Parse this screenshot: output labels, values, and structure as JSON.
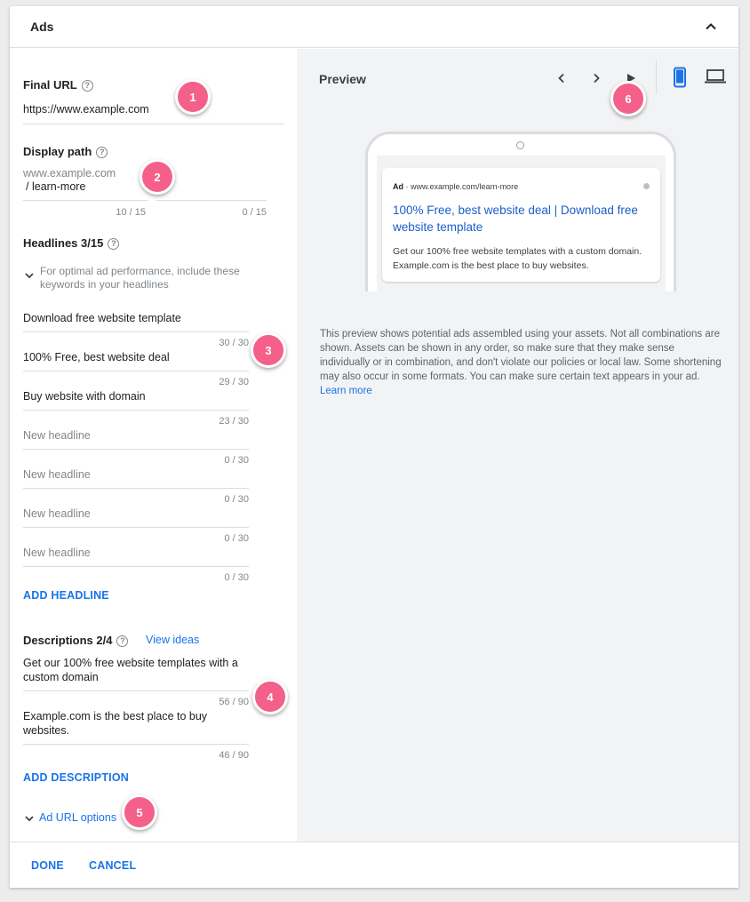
{
  "header": {
    "title": "Ads"
  },
  "final_url": {
    "label": "Final URL",
    "value": "https://www.example.com"
  },
  "display_path": {
    "label": "Display path",
    "domain": "www.example.com",
    "separator": "/",
    "path1": "learn-more",
    "path1_counter": "10 / 15",
    "path2_counter": "0 / 15"
  },
  "headlines": {
    "label": "Headlines 3/15",
    "keyword_tip": "For optimal ad performance, include these keywords in your headlines",
    "items": [
      {
        "value": "Download free website template",
        "placeholder": "",
        "counter": "30 / 30"
      },
      {
        "value": "100% Free,  best website deal",
        "placeholder": "",
        "counter": "29 / 30"
      },
      {
        "value": "Buy website with domain",
        "placeholder": "",
        "counter": "23 / 30"
      },
      {
        "value": "",
        "placeholder": "New headline",
        "counter": "0 / 30"
      },
      {
        "value": "",
        "placeholder": "New headline",
        "counter": "0 / 30"
      },
      {
        "value": "",
        "placeholder": "New headline",
        "counter": "0 / 30"
      },
      {
        "value": "",
        "placeholder": "New headline",
        "counter": "0 / 30"
      }
    ],
    "add_label": "ADD HEADLINE"
  },
  "descriptions": {
    "label": "Descriptions 2/4",
    "view_ideas": "View ideas",
    "items": [
      {
        "value": "Get our 100% free website templates with a custom domain",
        "counter": "56 / 90"
      },
      {
        "value": "Example.com is the best place to buy websites.",
        "counter": "46 / 90"
      }
    ],
    "add_label": "ADD DESCRIPTION"
  },
  "ad_url_options": {
    "label": "Ad URL options"
  },
  "preview": {
    "title": "Preview",
    "ad": {
      "ad_label": "Ad",
      "separator": "·",
      "display_url": "www.example.com/learn-more",
      "headline": "100% Free, best website deal | Download free website template",
      "description": "Get our 100% free website templates with a custom domain. Example.com is the best place to buy websites."
    },
    "note": "This preview shows potential ads assembled using your assets. Not all combinations are shown. Assets can be shown in any order, so make sure that they make sense individually or in combination, and don't violate our policies or local law. Some shortening may also occur in some formats. You can make sure certain text appears in your ad.",
    "learn_more": "Learn more"
  },
  "footer": {
    "done_label": "DONE",
    "cancel_label": "CANCEL"
  },
  "badges": [
    "1",
    "2",
    "3",
    "4",
    "5",
    "6"
  ],
  "colors": {
    "accent": "#1a73e8",
    "badge": "#f4608a",
    "mobile_active": "#1a73e8"
  }
}
